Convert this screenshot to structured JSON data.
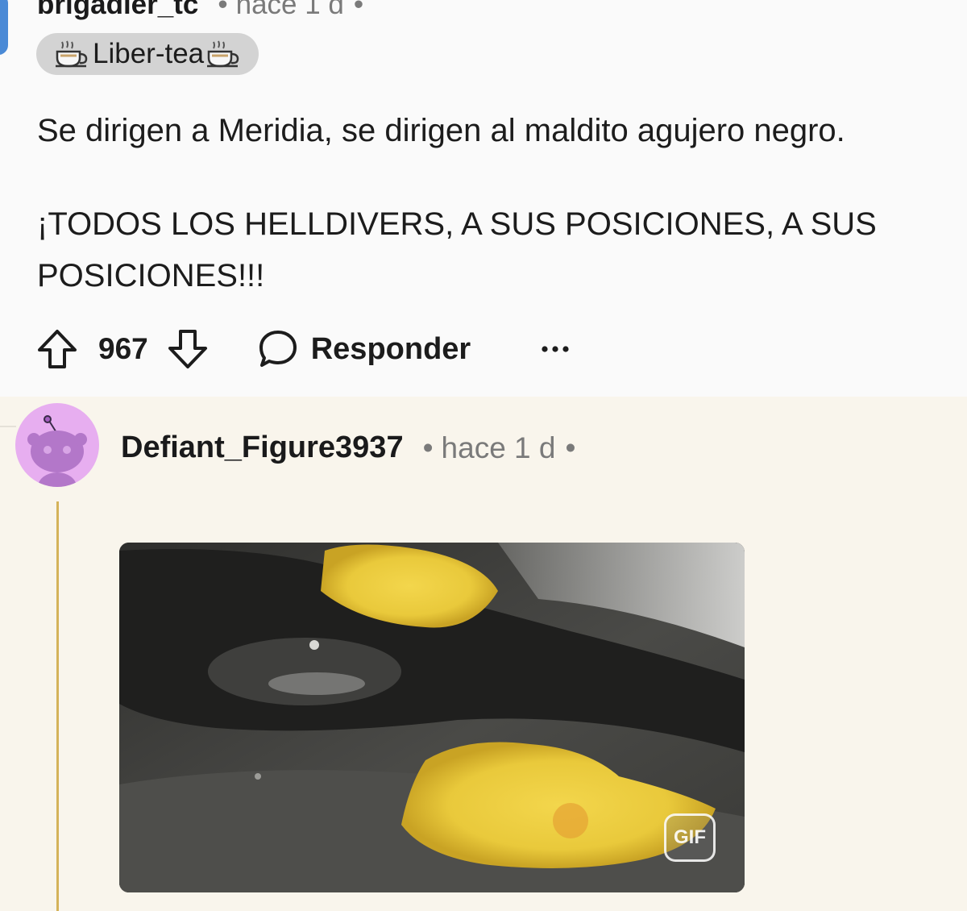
{
  "parent_comment": {
    "username": "brigadier_tc",
    "time": "hace 1 d",
    "flair": "Liber-tea",
    "flair_icon": "tea-cup-icon",
    "paragraphs": [
      "Se dirigen a Meridia, se dirigen al maldito agujero negro.",
      "¡TODOS LOS HELLDIVERS, A SUS POSICIONES, A SUS POSICIONES!!!"
    ],
    "score": "967",
    "reply_label": "Responder"
  },
  "reply_comment": {
    "username": "Defiant_Figure3937",
    "time": "hace 1 d",
    "media_badge": "GIF",
    "avatar_color": "#e7aef0"
  },
  "colors": {
    "thread_line": "#d5b35a",
    "reply_background": "#f9f5ec",
    "flair_background": "#d3d3d3"
  }
}
